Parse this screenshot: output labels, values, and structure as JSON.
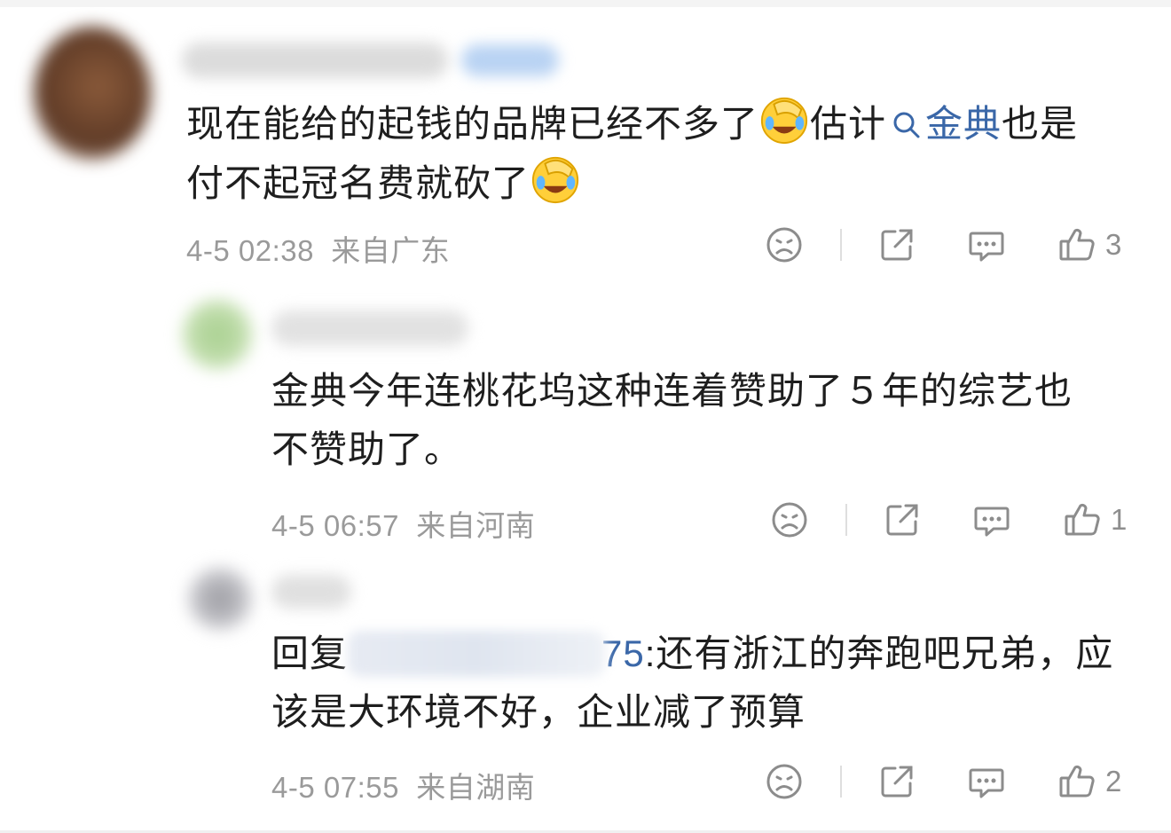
{
  "comments": [
    {
      "text_before": "现在能给的起钱的品牌已经不多了",
      "text_middle": "估计",
      "search_link": "金典",
      "text_after_line1": "也是",
      "line2": "付不起冠名费就砍了",
      "time": "4-5 02:38",
      "location": "来自广东",
      "likes": "3"
    },
    {
      "line1": "金典今年连桃花坞这种连着赞助了５年的综艺也",
      "line2": "不赞助了。",
      "time": "4-5 06:57",
      "location": "来自河南",
      "likes": "1"
    },
    {
      "reply_prefix": "回复",
      "mention_visible": "75",
      "line1_rest": ":还有浙江的奔跑吧兄弟，应",
      "line2": "该是大环境不好，企业减了预算",
      "time": "4-5 07:55",
      "location": "来自湖南",
      "likes": "2"
    }
  ],
  "icons": [
    "dislike-icon",
    "share-icon",
    "comment-icon",
    "like-icon",
    "search-icon",
    "facepalm-laugh-emoji"
  ],
  "colors": {
    "link": "#3a67a8",
    "meta": "#9a9a9a",
    "icon": "#8c8c8c"
  }
}
